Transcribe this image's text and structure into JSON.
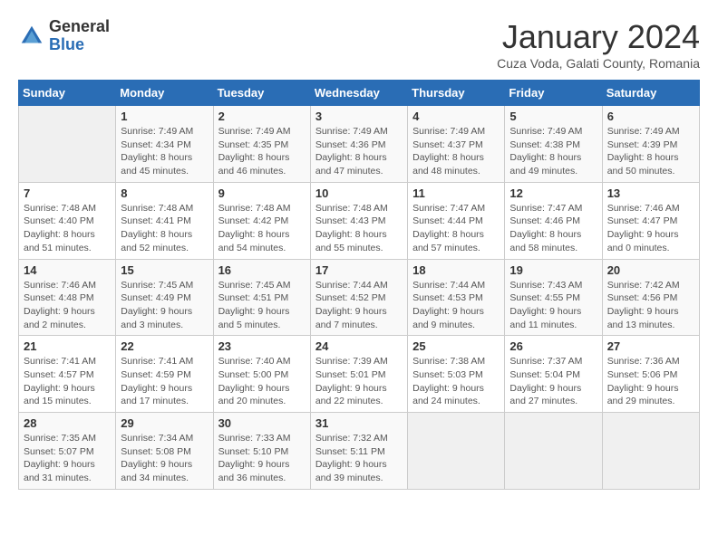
{
  "header": {
    "logo_general": "General",
    "logo_blue": "Blue",
    "title": "January 2024",
    "subtitle": "Cuza Voda, Galati County, Romania"
  },
  "days_of_week": [
    "Sunday",
    "Monday",
    "Tuesday",
    "Wednesday",
    "Thursday",
    "Friday",
    "Saturday"
  ],
  "weeks": [
    [
      {
        "day": "",
        "info": ""
      },
      {
        "day": "1",
        "info": "Sunrise: 7:49 AM\nSunset: 4:34 PM\nDaylight: 8 hours and 45 minutes."
      },
      {
        "day": "2",
        "info": "Sunrise: 7:49 AM\nSunset: 4:35 PM\nDaylight: 8 hours and 46 minutes."
      },
      {
        "day": "3",
        "info": "Sunrise: 7:49 AM\nSunset: 4:36 PM\nDaylight: 8 hours and 47 minutes."
      },
      {
        "day": "4",
        "info": "Sunrise: 7:49 AM\nSunset: 4:37 PM\nDaylight: 8 hours and 48 minutes."
      },
      {
        "day": "5",
        "info": "Sunrise: 7:49 AM\nSunset: 4:38 PM\nDaylight: 8 hours and 49 minutes."
      },
      {
        "day": "6",
        "info": "Sunrise: 7:49 AM\nSunset: 4:39 PM\nDaylight: 8 hours and 50 minutes."
      }
    ],
    [
      {
        "day": "7",
        "info": "Sunrise: 7:48 AM\nSunset: 4:40 PM\nDaylight: 8 hours and 51 minutes."
      },
      {
        "day": "8",
        "info": "Sunrise: 7:48 AM\nSunset: 4:41 PM\nDaylight: 8 hours and 52 minutes."
      },
      {
        "day": "9",
        "info": "Sunrise: 7:48 AM\nSunset: 4:42 PM\nDaylight: 8 hours and 54 minutes."
      },
      {
        "day": "10",
        "info": "Sunrise: 7:48 AM\nSunset: 4:43 PM\nDaylight: 8 hours and 55 minutes."
      },
      {
        "day": "11",
        "info": "Sunrise: 7:47 AM\nSunset: 4:44 PM\nDaylight: 8 hours and 57 minutes."
      },
      {
        "day": "12",
        "info": "Sunrise: 7:47 AM\nSunset: 4:46 PM\nDaylight: 8 hours and 58 minutes."
      },
      {
        "day": "13",
        "info": "Sunrise: 7:46 AM\nSunset: 4:47 PM\nDaylight: 9 hours and 0 minutes."
      }
    ],
    [
      {
        "day": "14",
        "info": "Sunrise: 7:46 AM\nSunset: 4:48 PM\nDaylight: 9 hours and 2 minutes."
      },
      {
        "day": "15",
        "info": "Sunrise: 7:45 AM\nSunset: 4:49 PM\nDaylight: 9 hours and 3 minutes."
      },
      {
        "day": "16",
        "info": "Sunrise: 7:45 AM\nSunset: 4:51 PM\nDaylight: 9 hours and 5 minutes."
      },
      {
        "day": "17",
        "info": "Sunrise: 7:44 AM\nSunset: 4:52 PM\nDaylight: 9 hours and 7 minutes."
      },
      {
        "day": "18",
        "info": "Sunrise: 7:44 AM\nSunset: 4:53 PM\nDaylight: 9 hours and 9 minutes."
      },
      {
        "day": "19",
        "info": "Sunrise: 7:43 AM\nSunset: 4:55 PM\nDaylight: 9 hours and 11 minutes."
      },
      {
        "day": "20",
        "info": "Sunrise: 7:42 AM\nSunset: 4:56 PM\nDaylight: 9 hours and 13 minutes."
      }
    ],
    [
      {
        "day": "21",
        "info": "Sunrise: 7:41 AM\nSunset: 4:57 PM\nDaylight: 9 hours and 15 minutes."
      },
      {
        "day": "22",
        "info": "Sunrise: 7:41 AM\nSunset: 4:59 PM\nDaylight: 9 hours and 17 minutes."
      },
      {
        "day": "23",
        "info": "Sunrise: 7:40 AM\nSunset: 5:00 PM\nDaylight: 9 hours and 20 minutes."
      },
      {
        "day": "24",
        "info": "Sunrise: 7:39 AM\nSunset: 5:01 PM\nDaylight: 9 hours and 22 minutes."
      },
      {
        "day": "25",
        "info": "Sunrise: 7:38 AM\nSunset: 5:03 PM\nDaylight: 9 hours and 24 minutes."
      },
      {
        "day": "26",
        "info": "Sunrise: 7:37 AM\nSunset: 5:04 PM\nDaylight: 9 hours and 27 minutes."
      },
      {
        "day": "27",
        "info": "Sunrise: 7:36 AM\nSunset: 5:06 PM\nDaylight: 9 hours and 29 minutes."
      }
    ],
    [
      {
        "day": "28",
        "info": "Sunrise: 7:35 AM\nSunset: 5:07 PM\nDaylight: 9 hours and 31 minutes."
      },
      {
        "day": "29",
        "info": "Sunrise: 7:34 AM\nSunset: 5:08 PM\nDaylight: 9 hours and 34 minutes."
      },
      {
        "day": "30",
        "info": "Sunrise: 7:33 AM\nSunset: 5:10 PM\nDaylight: 9 hours and 36 minutes."
      },
      {
        "day": "31",
        "info": "Sunrise: 7:32 AM\nSunset: 5:11 PM\nDaylight: 9 hours and 39 minutes."
      },
      {
        "day": "",
        "info": ""
      },
      {
        "day": "",
        "info": ""
      },
      {
        "day": "",
        "info": ""
      }
    ]
  ]
}
